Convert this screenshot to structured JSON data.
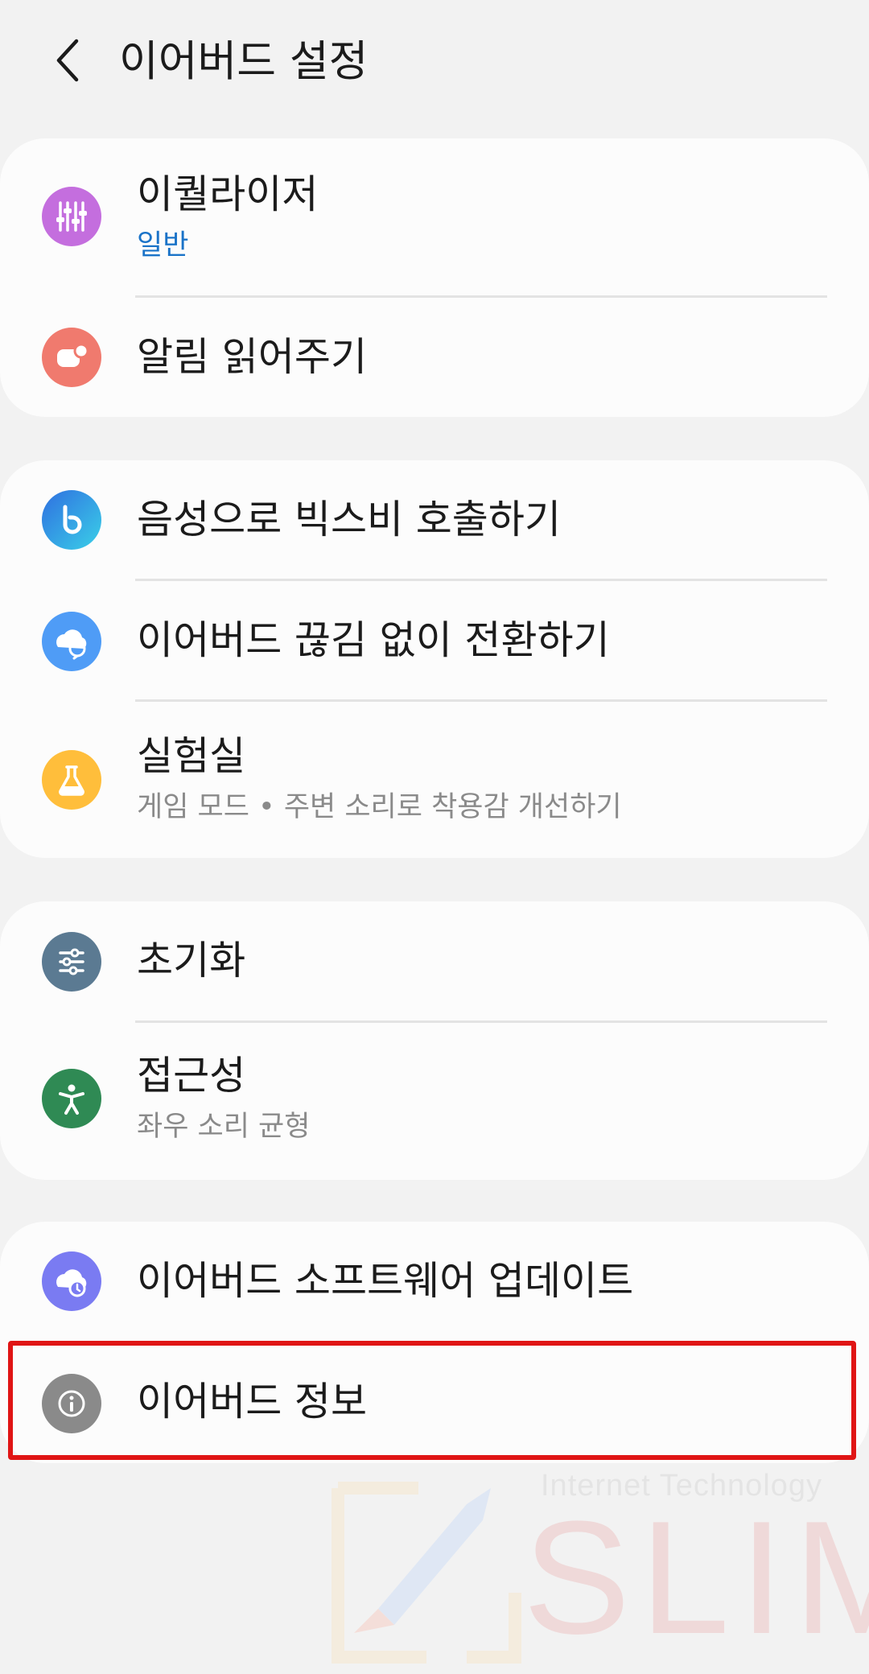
{
  "header": {
    "title": "이어버드 설정"
  },
  "groups": [
    {
      "items": [
        {
          "title": "이퀄라이저",
          "subtitle": "일반",
          "icon": "equalizer-icon",
          "color": "#c46ede"
        },
        {
          "title": "알림 읽어주기",
          "icon": "notification-reader-icon",
          "color": "#f07a6e"
        }
      ]
    },
    {
      "items": [
        {
          "title": "음성으로 빅스비 호출하기",
          "icon": "bixby-icon",
          "color": "#2f8be8"
        },
        {
          "title": "이어버드 끊김 없이 전환하기",
          "icon": "seamless-switch-icon",
          "color": "#4f9cf6"
        },
        {
          "title": "실험실",
          "subtitle": "게임 모드 • 주변 소리로 착용감 개선하기",
          "icon": "flask-icon",
          "color": "#ffbe3b"
        }
      ]
    },
    {
      "items": [
        {
          "title": "초기화",
          "icon": "reset-sliders-icon",
          "color": "#5b7a92"
        },
        {
          "title": "접근성",
          "subtitle": "좌우 소리 균형",
          "icon": "accessibility-icon",
          "color": "#2f8a54"
        }
      ]
    },
    {
      "items": [
        {
          "title": "이어버드 소프트웨어 업데이트",
          "icon": "software-update-icon",
          "color": "#7a7bf2"
        },
        {
          "title": "이어버드 정보",
          "icon": "info-icon",
          "color": "#8a8a8a"
        }
      ]
    }
  ],
  "watermark": {
    "small": "Internet Technology",
    "big": "SLIM"
  }
}
